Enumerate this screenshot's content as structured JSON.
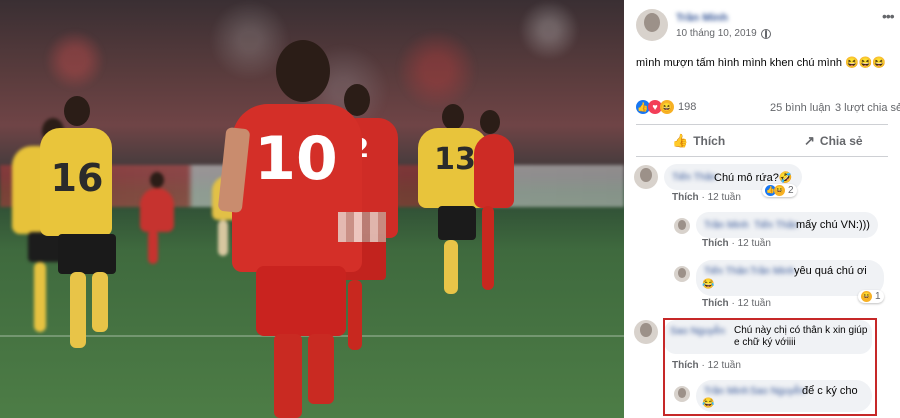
{
  "post": {
    "author": "Trần Minh",
    "date": "10 tháng 10, 2019",
    "privacy_icon": "public-icon",
    "more_icon": "more-icon",
    "text": "mình mượn tấm hình mình khen chú mình 😆😆😆",
    "reaction_count": "198",
    "comments_count": "25 bình luận",
    "shares_count": "3 lượt chia sẻ",
    "like_label": "Thích",
    "share_label": "Chia sẻ"
  },
  "photo": {
    "jersey_numbers": [
      "10",
      "16",
      "13",
      "2"
    ]
  },
  "comments": [
    {
      "author": "Tiến Thân",
      "text": "Chú mô rứa?🤣",
      "action": "Thích",
      "time": "12 tuần",
      "reaction_count": "2",
      "replies": [
        {
          "author": "Trần Minh",
          "mention": "Tiến Thân",
          "text": "mấy chú VN:)))",
          "action": "Thích",
          "time": "12 tuần"
        },
        {
          "author": "Tiến Thân",
          "mention": "Trần Minh",
          "text": "yêu quá chú ơi",
          "emoji": "😂",
          "action": "Thích",
          "time": "12 tuần",
          "reaction_count": "1"
        }
      ]
    },
    {
      "author": "Sao Nguyễn",
      "text": "Chú này chị có thân k xin giúp e chữ ký vớiiii",
      "action": "Thích",
      "time": "12 tuần",
      "replies": [
        {
          "author": "Trần Minh",
          "mention": "Sao Nguyễn",
          "text": "để c ký cho",
          "emoji": "😂"
        }
      ]
    }
  ],
  "colors": {
    "link": "#385898",
    "muted": "#65676b",
    "bubble": "#f0f2f5",
    "highlight_border": "#c62828",
    "like_blue": "#1877f2"
  }
}
